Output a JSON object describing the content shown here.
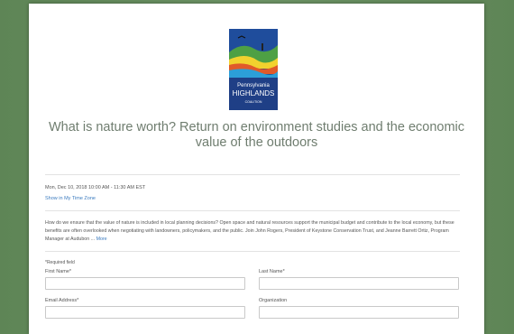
{
  "logo": {
    "line1": "Pennsylvania",
    "line2": "HIGHLANDS",
    "line3": "COALITION",
    "colors": {
      "sky": "#1f4d9c",
      "green": "#4ea044",
      "yellow": "#f2d22e",
      "blue": "#1a5fb4"
    }
  },
  "event": {
    "title": "What is nature worth? Return on environment studies and the economic value of the outdoors",
    "date": "Mon, Dec 10, 2018 10:00 AM - 11:30 AM EST",
    "timezone_link": "Show in My Time Zone",
    "description": "How do we ensure that the value of nature is included in local planning decisions? Open space and natural resources support the municipal budget and contribute to the local economy, but these benefits are often overlooked when negotiating with landowners, policymakers, and the public. Join John Rogers, President of Keystone Conservation Trust, and Jeanne Barrett Ortiz, Program Manager at Audubon ...",
    "more_link": "More"
  },
  "form": {
    "required_note": "*Required field",
    "fields": [
      {
        "label": "First Name*",
        "value": ""
      },
      {
        "label": "Last Name*",
        "value": ""
      },
      {
        "label": "Email Address*",
        "value": ""
      },
      {
        "label": "Organization",
        "value": ""
      }
    ]
  },
  "colors": {
    "background": "#6a8f62",
    "title": "#6f7d6f",
    "link": "#3b7bbf"
  }
}
